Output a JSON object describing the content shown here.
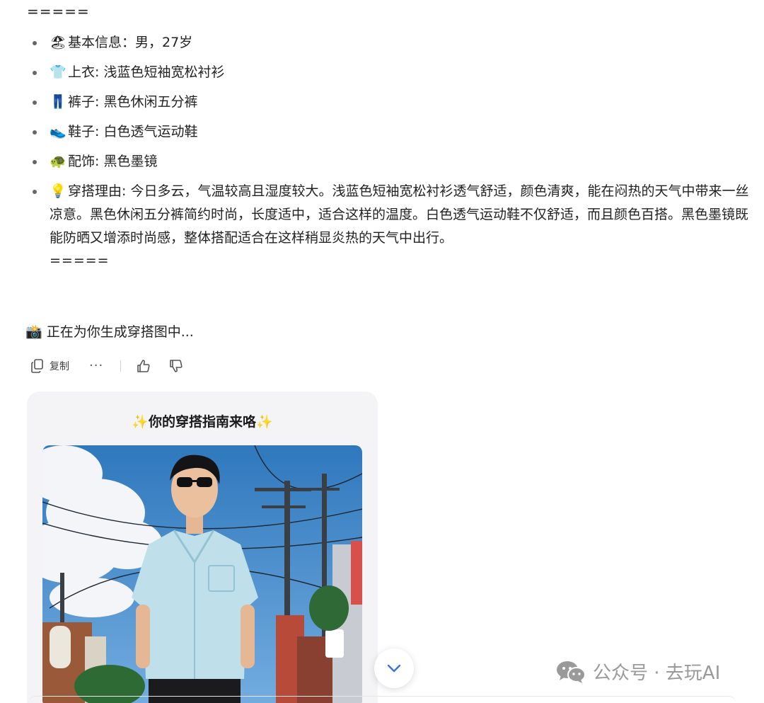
{
  "separator_top": "=====",
  "items": [
    {
      "icon": "🏖",
      "label": "基本信息：男，27岁"
    },
    {
      "icon": "👕",
      "label": "上衣: 浅蓝色短袖宽松衬衫"
    },
    {
      "icon": "👖",
      "label": "裤子: 黑色休闲五分裤"
    },
    {
      "icon": "👟",
      "label": "鞋子: 白色透气运动鞋"
    },
    {
      "icon": "🐢",
      "label": "配饰: 黑色墨镜"
    },
    {
      "icon": "💡",
      "label": "穿搭理由: 今日多云，气温较高且湿度较大。浅蓝色短袖宽松衬衫透气舒适，颜色清爽，能在闷热的天气中带来一丝凉意。黑色休闲五分裤简约时尚，长度适中，适合这样的温度。白色透气运动鞋不仅舒适，而且颜色百搭。黑色墨镜既能防晒又增添时尚感，整体搭配适合在这样稍显炎热的天气中出行。"
    }
  ],
  "separator_bottom": "=====",
  "status": {
    "icon": "📸",
    "text": "正在为你生成穿搭图中..."
  },
  "actions": {
    "copy": "复制",
    "more": "···"
  },
  "card": {
    "spark_left": "✨",
    "title": "你的穿搭指南来咯",
    "spark_right": "✨"
  },
  "watermark": "公众号 · 去玩AI",
  "colors": {
    "card_bg": "#f4f4f6",
    "sky": "#3f86c6",
    "shirt": "#bfe0ea",
    "watermark": "#9a9a9a",
    "scroll_icon": "#3a6fe0"
  }
}
